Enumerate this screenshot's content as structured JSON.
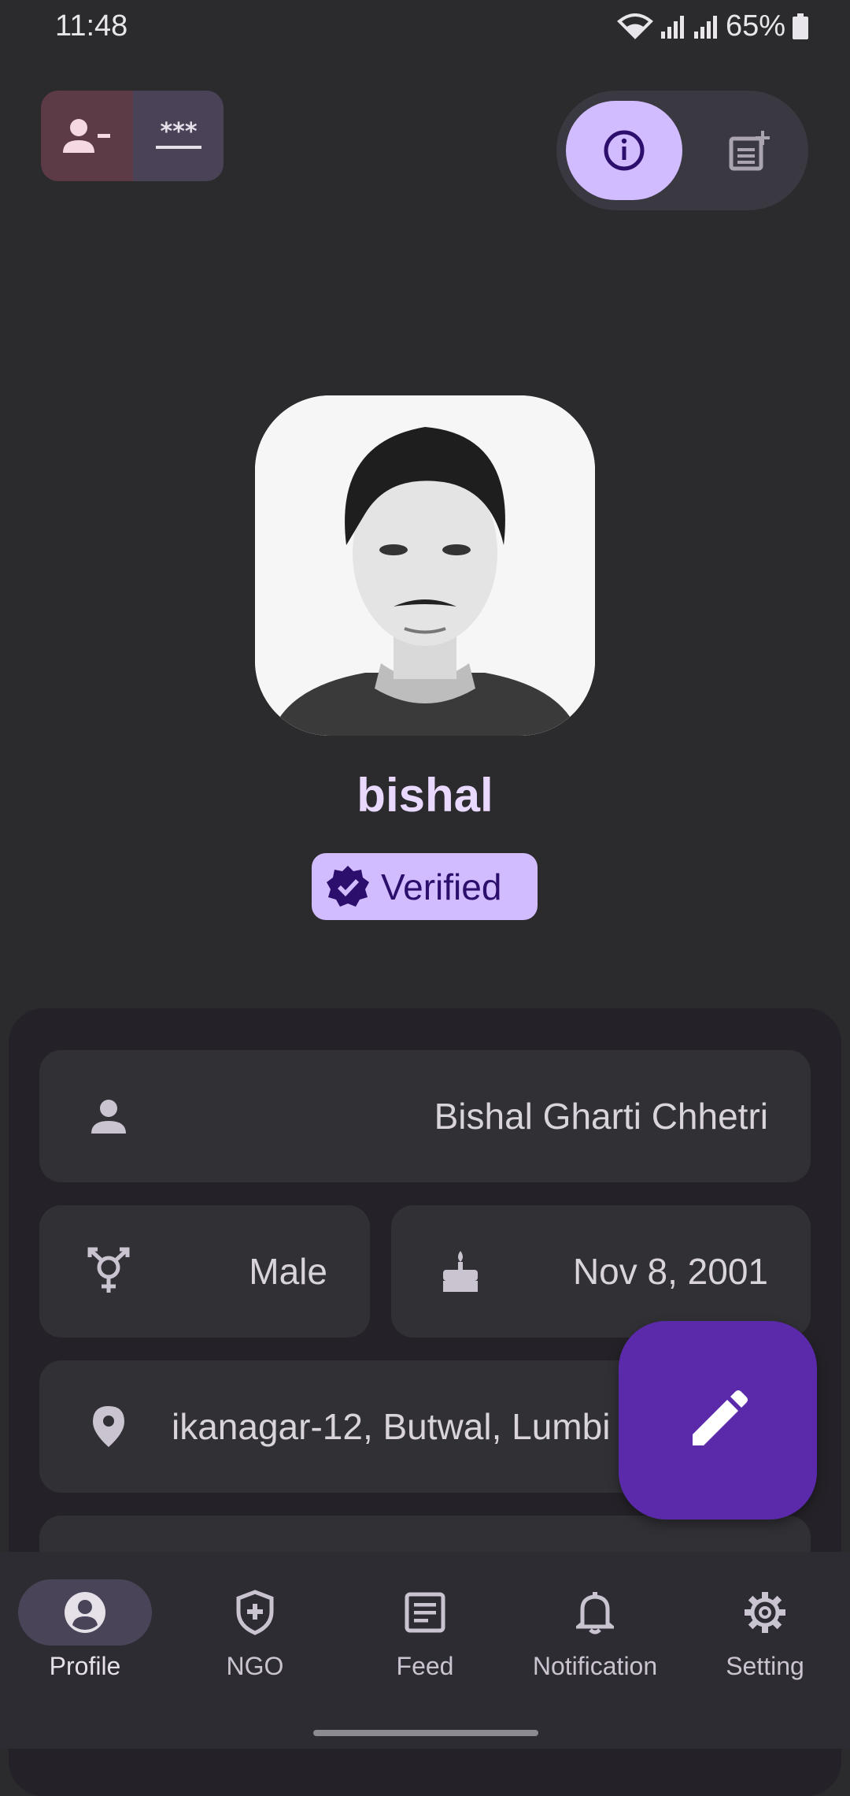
{
  "status_bar": {
    "time": "11:48",
    "battery": "65%"
  },
  "profile": {
    "username": "bishal",
    "verified_label": "Verified",
    "full_name": "Bishal Gharti Chhetri",
    "gender": "Male",
    "dob": "Nov 8, 2001",
    "address": "ikanagar-12, Butwal, Lumbi"
  },
  "top_actions": {
    "password_glyph": "***"
  },
  "nav": {
    "items": [
      {
        "label": "Profile",
        "icon": "account-circle-icon",
        "active": true
      },
      {
        "label": "NGO",
        "icon": "shield-plus-icon",
        "active": false
      },
      {
        "label": "Feed",
        "icon": "article-icon",
        "active": false
      },
      {
        "label": "Notification",
        "icon": "bell-icon",
        "active": false
      },
      {
        "label": "Setting",
        "icon": "gear-icon",
        "active": false
      }
    ]
  },
  "colors": {
    "accent": "#d0bcff",
    "fab": "#5a2aab",
    "background": "#2b2a2d"
  }
}
